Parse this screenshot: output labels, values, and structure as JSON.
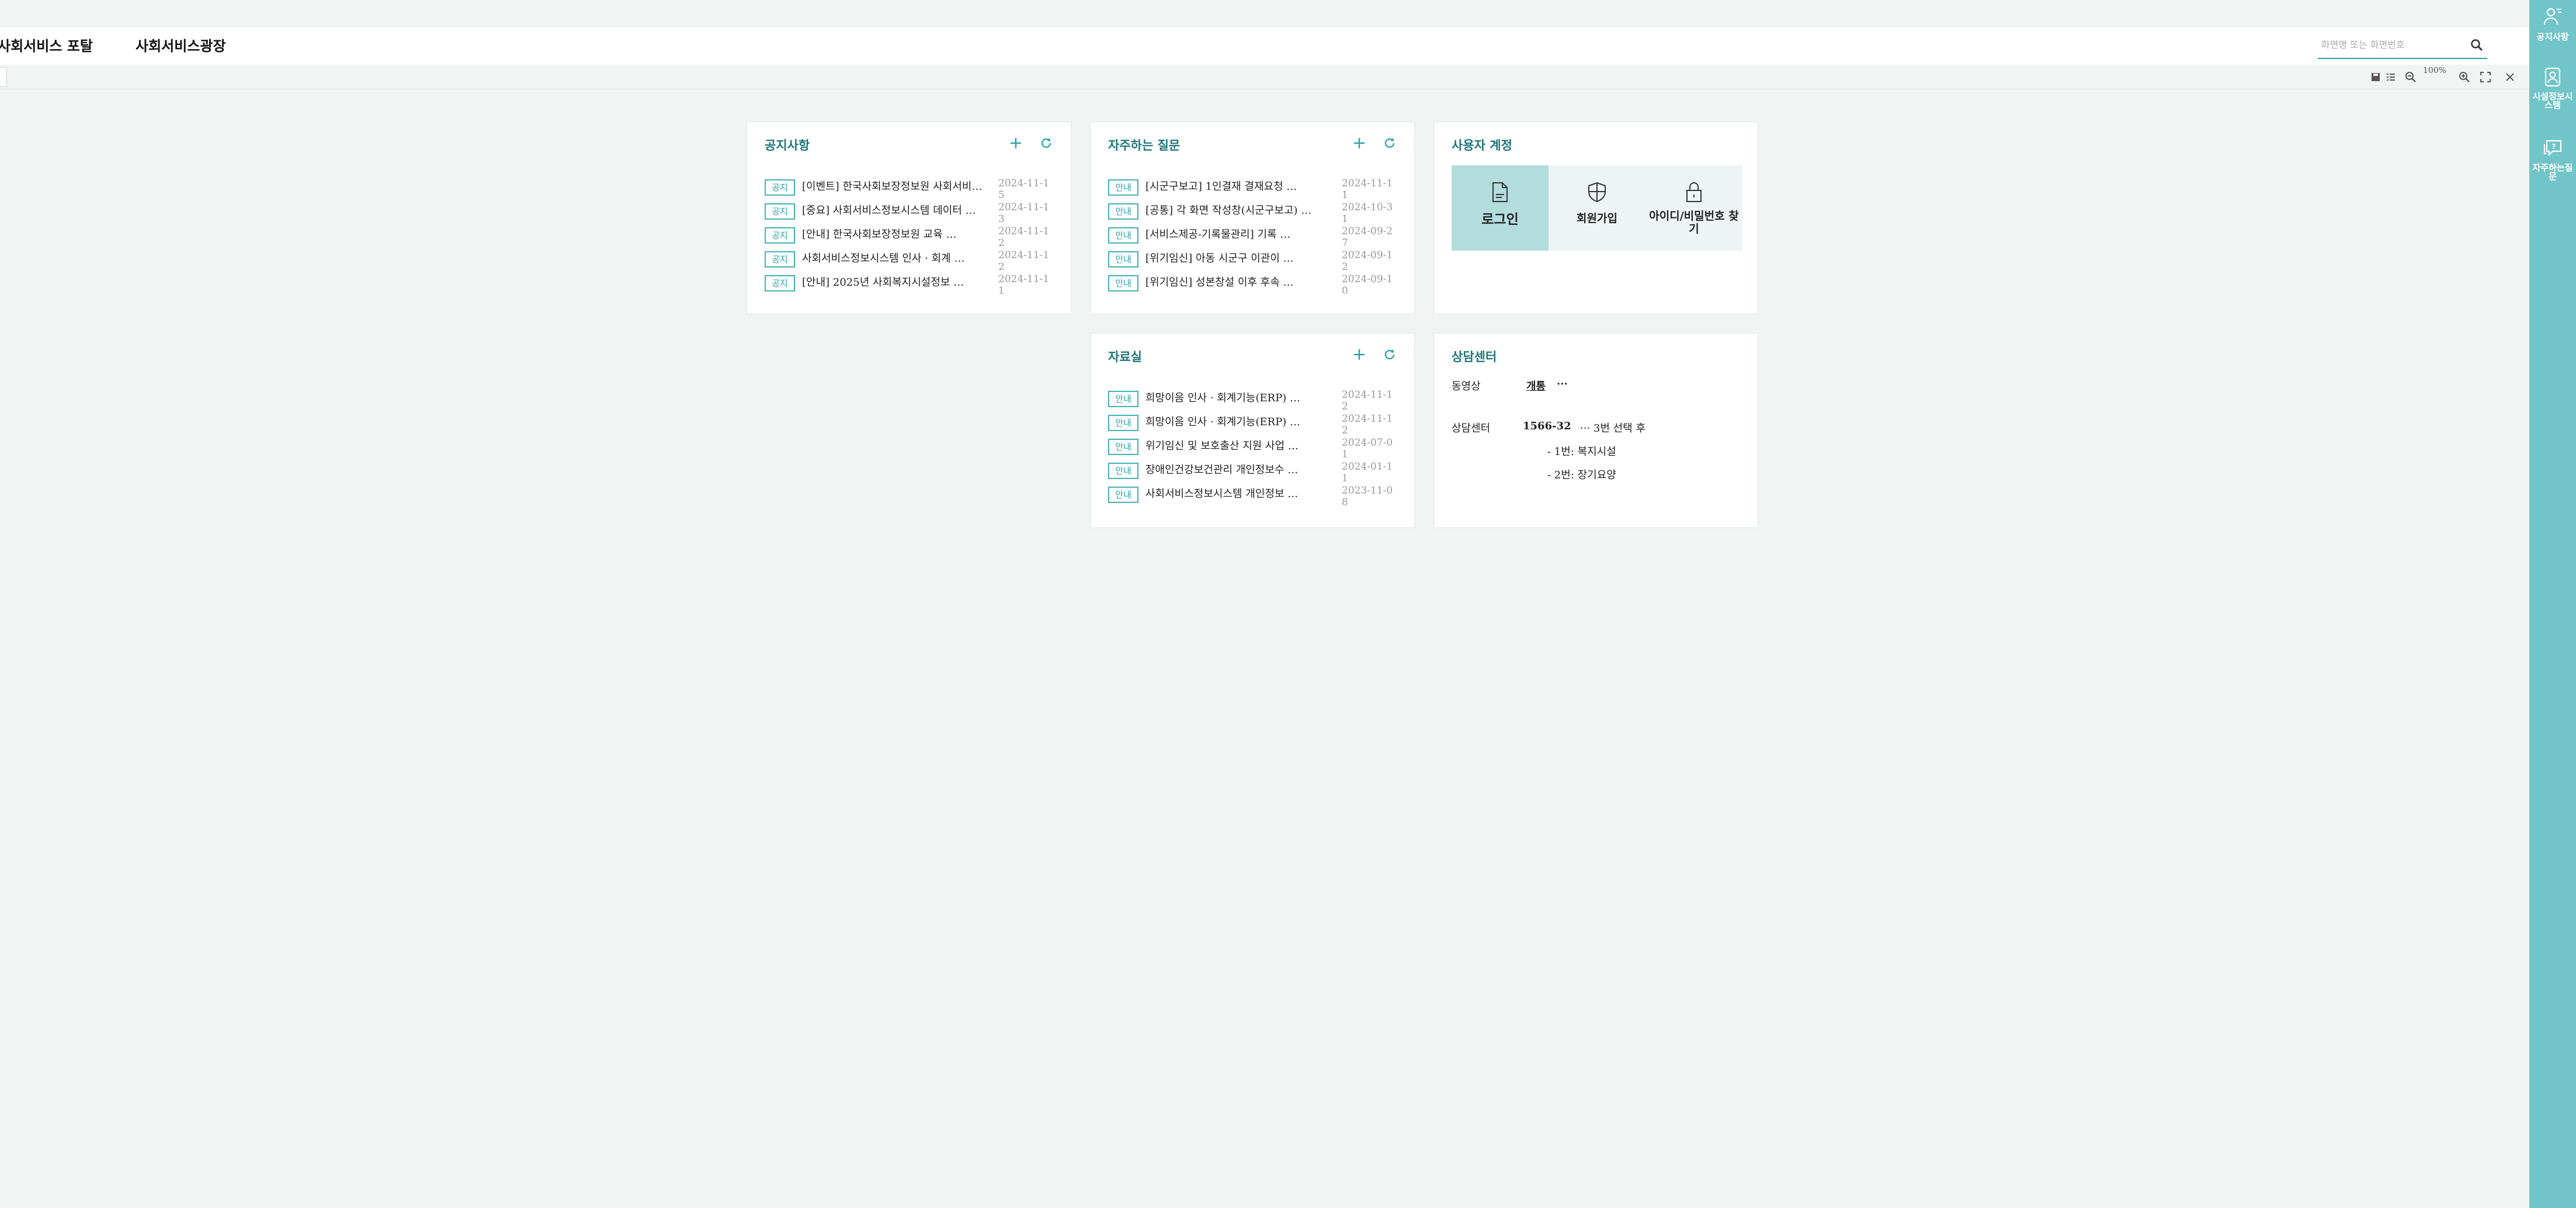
{
  "header": {
    "nav": [
      "사회서비스 포탈",
      "사회서비스광장"
    ],
    "search": {
      "placeholder": "화면명 또는 화면번호",
      "icon": "search-icon"
    }
  },
  "toolbar": {
    "zoom_level": "100%",
    "icons": [
      "save-icon",
      "list-icon",
      "zoom-out-icon",
      "zoom-in-icon",
      "fullscreen-icon",
      "close-icon"
    ]
  },
  "notice": {
    "title": "공지사항",
    "items": [
      {
        "badge": "공지",
        "title": "[이벤트] 한국사회보장정보원 사회서비스 …",
        "date": "2024-11-15"
      },
      {
        "badge": "공지",
        "title": "[중요] 사회서비스정보시스템 데이터 …",
        "date": "2024-11-13"
      },
      {
        "badge": "공지",
        "title": "[안내] 한국사회보장정보원 교육 …",
        "date": "2024-11-12"
      },
      {
        "badge": "공지",
        "title": "사회서비스정보시스템 인사 · 회계 …",
        "date": "2024-11-12"
      },
      {
        "badge": "공지",
        "title": "[안내] 2025년 사회복지시설정보 …",
        "date": "2024-11-11"
      }
    ]
  },
  "faq": {
    "title": "자주하는 질문",
    "items": [
      {
        "badge": "안내",
        "title": "[시군구보고] 1인결재 결재요청 …",
        "date": "2024-11-11"
      },
      {
        "badge": "안내",
        "title": "[공통] 각 화면 작성창(시군구보고) …",
        "date": "2024-10-31"
      },
      {
        "badge": "안내",
        "title": "[서비스제공-기록물관리] 기록 …",
        "date": "2024-09-27"
      },
      {
        "badge": "안내",
        "title": "[위기임신] 아동 시군구 이관이 …",
        "date": "2024-09-12"
      },
      {
        "badge": "안내",
        "title": "[위기임신] 성본창설 이후 후속 …",
        "date": "2024-09-10"
      }
    ]
  },
  "archive": {
    "title": "자료실",
    "items": [
      {
        "badge": "안내",
        "title": "희망이음 인사 · 회계기능(ERP) …",
        "date": "2024-11-12"
      },
      {
        "badge": "안내",
        "title": "희망이음 인사 · 회계기능(ERP) …",
        "date": "2024-11-12"
      },
      {
        "badge": "안내",
        "title": "위기임신 및 보호출산 지원 사업 …",
        "date": "2024-07-01"
      },
      {
        "badge": "안내",
        "title": "장애인건강보건관리 개인정보수 …",
        "date": "2024-01-11"
      },
      {
        "badge": "안내",
        "title": "사회서비스정보시스템 개인정보 …",
        "date": "2023-11-08"
      }
    ]
  },
  "account": {
    "title": "사용자 계정",
    "buttons": [
      {
        "label": "로그인",
        "icon": "login-document-icon"
      },
      {
        "label": "회원가입",
        "icon": "shield-icon"
      },
      {
        "label": "아이디/비밀번호 찾기",
        "icon": "lock-icon"
      }
    ]
  },
  "consult": {
    "title": "상담센터",
    "video_label": "동영상",
    "video_link": "개통",
    "video_more": "···",
    "center_label": "상담센터",
    "phone": "1566-32",
    "phone_rest": "··· 3번 선택 후",
    "option1": "- 1번: 복지시설",
    "option2": "- 2번: 장기요양"
  },
  "sidebar": {
    "items": [
      {
        "label": "공지사항",
        "icon": "person-icon"
      },
      {
        "label": "시설정보시스템",
        "icon": "id-card-icon"
      },
      {
        "label": "자주하는질문",
        "icon": "chat-question-icon"
      }
    ]
  },
  "colors": {
    "accent": "#2aa3a8",
    "title": "#1f7478",
    "sidebar": "#71c4c7",
    "background": "#f0f5f4"
  }
}
